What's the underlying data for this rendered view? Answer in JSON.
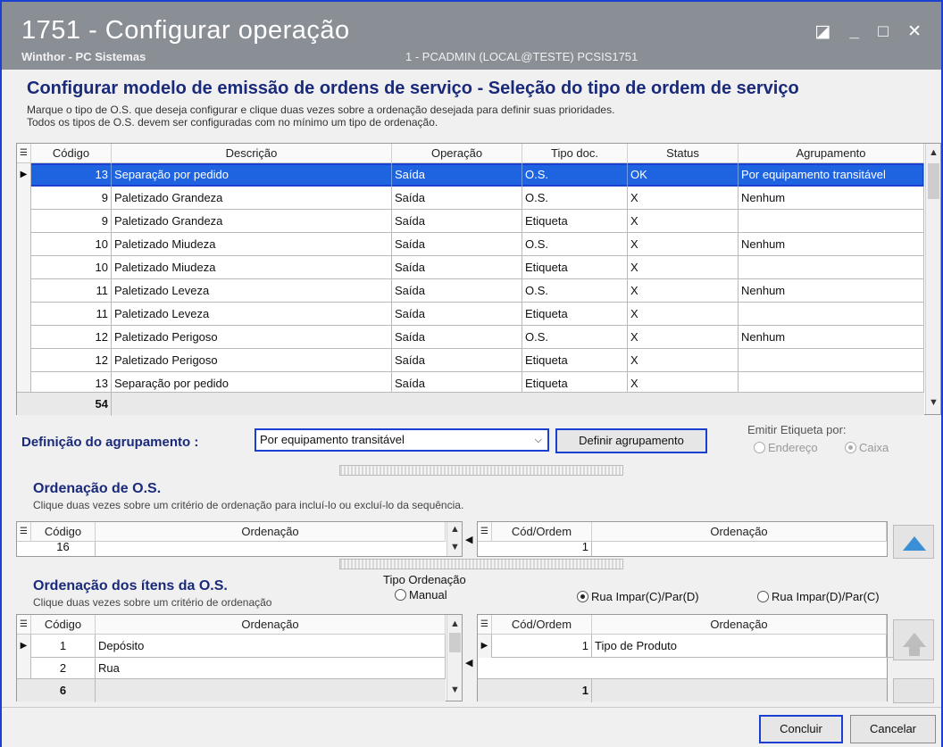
{
  "window": {
    "title": "1751 - Configurar operação",
    "subtitle": "Winthor - PC Sistemas",
    "user_info": "1 - PCADMIN (LOCAL@TESTE)   PCSIS1751",
    "controls": "◪ _ □ ✕"
  },
  "header": {
    "title": "Configurar modelo de emissão de ordens de serviço - Seleção do tipo de ordem de serviço",
    "line1": "Marque o tipo de O.S. que deseja configurar e clique duas vezes sobre a ordenação desejada para definir suas prioridades.",
    "line2": "Todos os tipos de O.S. devem ser configuradas com no mínimo um tipo de ordenação."
  },
  "main_grid": {
    "columns": [
      "Código",
      "Descrição",
      "Operação",
      "Tipo doc.",
      "Status",
      "Agrupamento"
    ],
    "rows": [
      [
        "13",
        "Separação por pedido",
        "Saída",
        "O.S.",
        "OK",
        "Por equipamento transitável"
      ],
      [
        "9",
        "Paletizado Grandeza",
        "Saída",
        "O.S.",
        "X",
        "Nenhum"
      ],
      [
        "9",
        "Paletizado Grandeza",
        "Saída",
        "Etiqueta",
        "X",
        ""
      ],
      [
        "10",
        "Paletizado Miudeza",
        "Saída",
        "O.S.",
        "X",
        "Nenhum"
      ],
      [
        "10",
        "Paletizado Miudeza",
        "Saída",
        "Etiqueta",
        "X",
        ""
      ],
      [
        "11",
        "Paletizado Leveza",
        "Saída",
        "O.S.",
        "X",
        "Nenhum"
      ],
      [
        "11",
        "Paletizado Leveza",
        "Saída",
        "Etiqueta",
        "X",
        ""
      ],
      [
        "12",
        "Paletizado Perigoso",
        "Saída",
        "O.S.",
        "X",
        "Nenhum"
      ],
      [
        "12",
        "Paletizado Perigoso",
        "Saída",
        "Etiqueta",
        "X",
        ""
      ],
      [
        "13",
        "Separação por pedido",
        "Saída",
        "Etiqueta",
        "X",
        ""
      ]
    ],
    "footer_count": "54"
  },
  "agrupamento": {
    "label": "Definição do agrupamento :",
    "selected": "Por equipamento transitável",
    "button": "Definir agrupamento",
    "emitir_label": "Emitir Etiqueta por:",
    "opt_endereco": "Endereço",
    "opt_caixa": "Caixa"
  },
  "ordenacao_os": {
    "title": "Ordenação de O.S.",
    "desc": "Clique duas vezes sobre um critério de ordenação para incluí-lo ou excluí-lo da sequência.",
    "left_cols": [
      "Código",
      "Ordenação"
    ],
    "left_partial_value": "16",
    "right_cols": [
      "Cód/Ordem",
      "Ordenação"
    ],
    "right_partial_value": "1"
  },
  "ordenacao_itens": {
    "title": "Ordenação dos ítens da O.S.",
    "desc": "Clique duas vezes sobre um critério de ordenação",
    "tipo_label": "Tipo Ordenação",
    "opt_manual": "Manual",
    "opt_rua_c": "Rua Impar(C)/Par(D)",
    "opt_rua_d": "Rua Impar(D)/Par(C)",
    "left_cols": [
      "Código",
      "Ordenação"
    ],
    "left_rows": [
      [
        "1",
        "Depósito"
      ],
      [
        "2",
        "Rua"
      ]
    ],
    "left_footer": "6",
    "right_cols": [
      "Cód/Ordem",
      "Ordenação"
    ],
    "right_rows": [
      [
        "1",
        "Tipo de Produto"
      ]
    ],
    "right_footer": "1"
  },
  "buttons": {
    "concluir": "Concluir",
    "cancelar": "Cancelar"
  },
  "colors": {
    "accent": "#1b3fd0",
    "selection": "#1e63e0",
    "heading": "#1a2a7a",
    "titlebar": "#8a8f96"
  }
}
